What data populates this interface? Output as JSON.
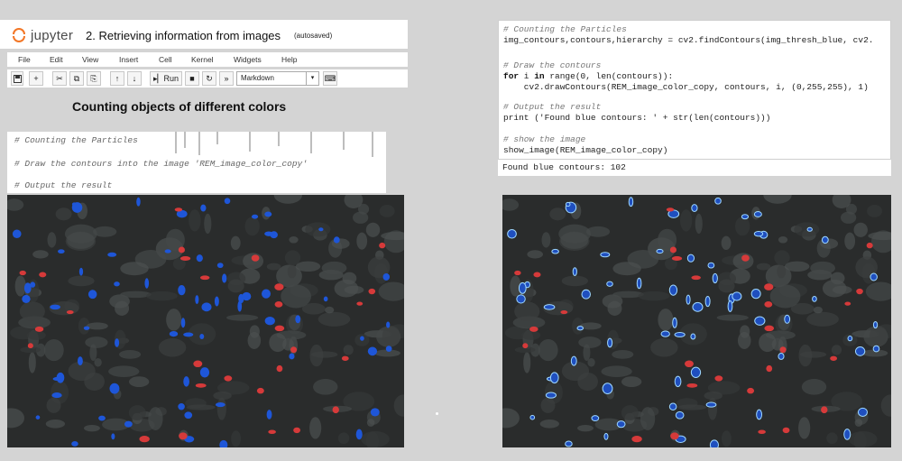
{
  "header": {
    "logo_text": "jupyter",
    "notebook_title": "2. Retrieving information from images",
    "save_status": "(autosaved)"
  },
  "menu": [
    "File",
    "Edit",
    "View",
    "Insert",
    "Cell",
    "Kernel",
    "Widgets",
    "Help"
  ],
  "toolbar": {
    "run_label": "Run",
    "cell_type": "Markdown"
  },
  "section_heading": "Counting objects of different colors",
  "left_code": [
    "# Counting the Particles",
    "# Draw the contours into the image 'REM_image_color_copy'",
    "# Output the result"
  ],
  "right_code": [
    {
      "text": "# Counting the Particles",
      "kind": "comment"
    },
    {
      "text": "img_contours,contours,hierarchy = cv2.findContours(img_thresh_blue, cv2.",
      "kind": "code"
    },
    {
      "text": "",
      "kind": "blank"
    },
    {
      "text": "# Draw the contours",
      "kind": "comment"
    },
    {
      "text": "for i in range(0, len(contours)):",
      "kind": "code"
    },
    {
      "text": "    cv2.drawContours(REM_image_color_copy, contours, i, (0,255,255), 1)",
      "kind": "code"
    },
    {
      "text": "",
      "kind": "blank"
    },
    {
      "text": "# Output the result",
      "kind": "comment"
    },
    {
      "text": "print ('Found blue contours: ' + str(len(contours)))",
      "kind": "code"
    },
    {
      "text": "",
      "kind": "blank"
    },
    {
      "text": "# show the image",
      "kind": "comment"
    },
    {
      "text": "show_image(REM_image_color_copy)",
      "kind": "code"
    }
  ],
  "output_text": "Found blue contours: 102",
  "colors": {
    "blue_particle": "#1e56d8",
    "red_particle": "#d63a3a",
    "contour": "#9fd8ff",
    "background": "#2a2c2c"
  }
}
